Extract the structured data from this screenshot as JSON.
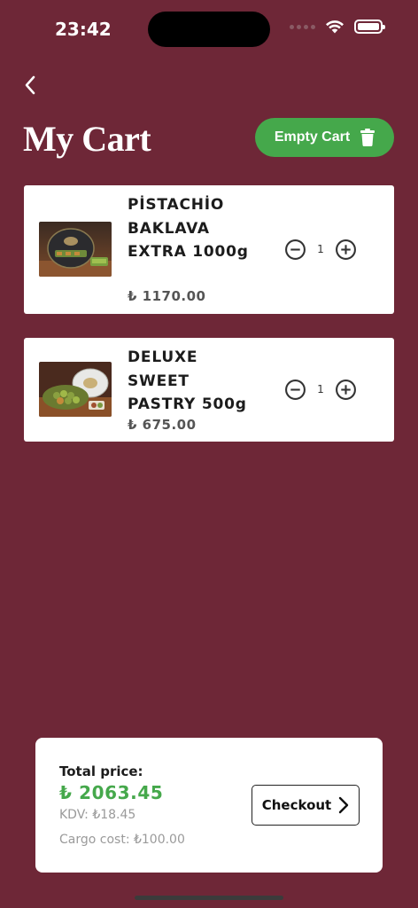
{
  "status_bar": {
    "time": "23:42"
  },
  "header": {
    "title": "My Cart",
    "empty_cart_label": "Empty Cart"
  },
  "cart": {
    "items": [
      {
        "name": "PİSTACHİO BAKLAVA EXTRA 1000g",
        "price": "₺ 1170.00",
        "quantity": "1"
      },
      {
        "name": "DELUXE SWEET PASTRY 500g",
        "price": "₺ 675.00",
        "quantity": "1"
      }
    ]
  },
  "summary": {
    "total_label": "Total price:",
    "total_value": "₺ 2063.45",
    "kdv": "KDV: ₺18.45",
    "cargo": "Cargo cost: ₺100.00",
    "checkout_label": "Checkout"
  },
  "colors": {
    "background": "#6e2737",
    "accent_green": "#45a84b",
    "card": "#ffffff"
  }
}
